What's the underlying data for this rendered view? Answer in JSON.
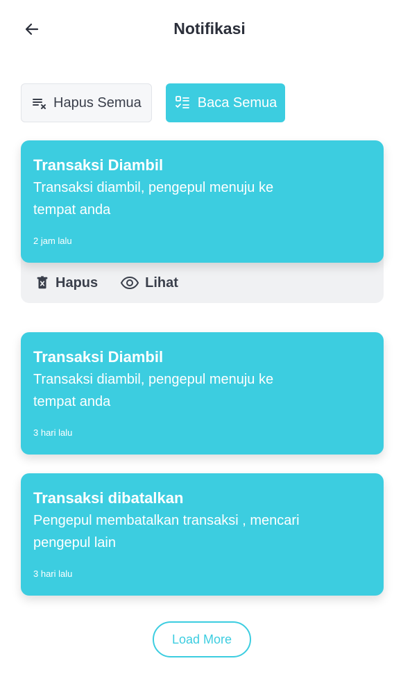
{
  "header": {
    "title": "Notifikasi",
    "back_icon": "arrow-left-icon"
  },
  "actions": {
    "clear_all_label": "Hapus Semua",
    "read_all_label": "Baca Semua"
  },
  "notifications": [
    {
      "title": "Transaksi Diambil",
      "body": "Transaksi diambil, pengepul menuju ke tempat anda",
      "time": "2 jam lalu",
      "delete_label": "Hapus",
      "view_label": "Lihat"
    },
    {
      "title": "Transaksi Diambil",
      "body": "Transaksi diambil, pengepul menuju ke tempat anda",
      "time": "3 hari lalu"
    },
    {
      "title": "Transaksi dibatalkan",
      "body": "Pengepul membatalkan transaksi , mencari pengepul lain",
      "time": "3 hari lalu"
    }
  ],
  "load_more_label": "Load More",
  "colors": {
    "accent": "#3ccde0",
    "text": "#2b2f3a"
  }
}
